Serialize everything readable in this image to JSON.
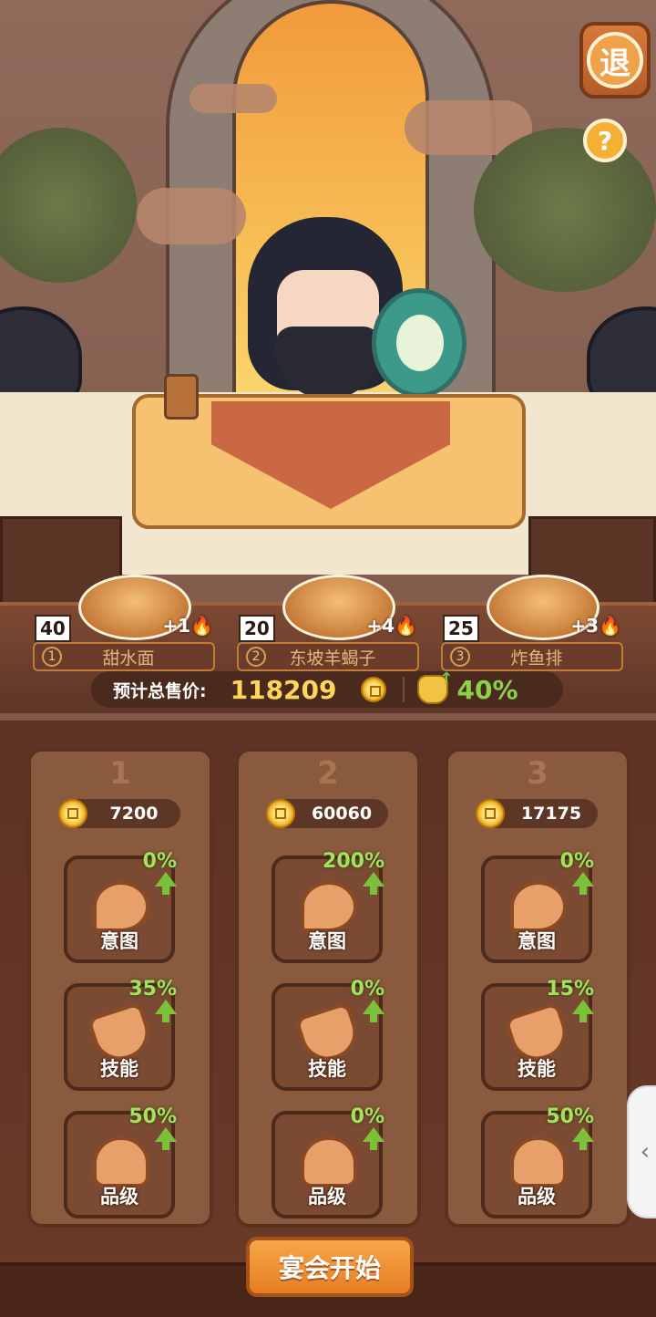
{
  "header": {
    "exit_button_label": "退",
    "help_button_label": "?"
  },
  "dishes": [
    {
      "index": "1",
      "name": "甜水面",
      "count": "40",
      "bonus": "+1"
    },
    {
      "index": "2",
      "name": "东坡羊蝎子",
      "count": "20",
      "bonus": "+4"
    },
    {
      "index": "3",
      "name": "炸鱼排",
      "count": "25",
      "bonus": "+3"
    }
  ],
  "sales": {
    "label": "预计总售价:",
    "value": "118209",
    "bonus_percent": "40%"
  },
  "columns": [
    {
      "number": "1",
      "cost": "7200",
      "upgrades": [
        {
          "label": "意图",
          "percent": "0%",
          "icon": "spoon-icon"
        },
        {
          "label": "技能",
          "percent": "35%",
          "icon": "key-icon"
        },
        {
          "label": "品级",
          "percent": "50%",
          "icon": "thumbs-up-icon"
        }
      ]
    },
    {
      "number": "2",
      "cost": "60060",
      "upgrades": [
        {
          "label": "意图",
          "percent": "200%",
          "icon": "spoon-icon"
        },
        {
          "label": "技能",
          "percent": "0%",
          "icon": "key-icon"
        },
        {
          "label": "品级",
          "percent": "0%",
          "icon": "thumbs-up-icon"
        }
      ]
    },
    {
      "number": "3",
      "cost": "17175",
      "upgrades": [
        {
          "label": "意图",
          "percent": "0%",
          "icon": "spoon-icon"
        },
        {
          "label": "技能",
          "percent": "15%",
          "icon": "key-icon"
        },
        {
          "label": "品级",
          "percent": "50%",
          "icon": "thumbs-up-icon"
        }
      ]
    }
  ],
  "start_button_label": "宴会开始",
  "side_handle_glyph": "‹",
  "colors": {
    "accent_orange": "#e57e22",
    "sales_gold": "#ffd65a",
    "bonus_green": "#8bd24a",
    "panel_brown": "#6b3a28"
  }
}
